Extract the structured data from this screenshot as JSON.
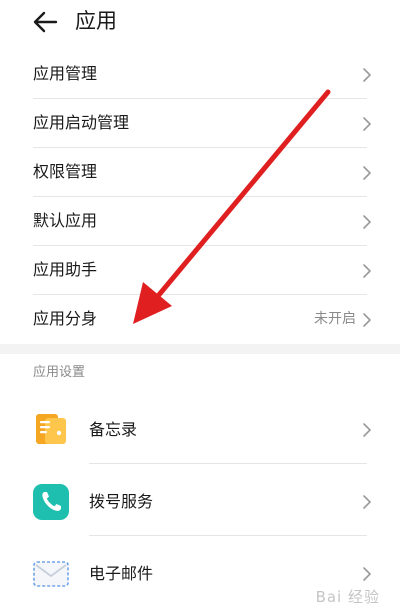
{
  "header": {
    "title": "应用",
    "back_icon": "back-arrow-icon"
  },
  "settings_items": [
    {
      "label": "应用管理"
    },
    {
      "label": "应用启动管理"
    },
    {
      "label": "权限管理"
    },
    {
      "label": "默认应用"
    },
    {
      "label": "应用助手"
    },
    {
      "label": "应用分身",
      "status": "未开启"
    }
  ],
  "section": {
    "title": "应用设置"
  },
  "apps": [
    {
      "label": "备忘录",
      "icon": "notes-app-icon",
      "color": "#f5a623"
    },
    {
      "label": "拨号服务",
      "icon": "phone-app-icon",
      "color": "#1fbfb0"
    },
    {
      "label": "电子邮件",
      "icon": "mail-app-icon",
      "color": "#6fa3e8"
    }
  ],
  "annotation": {
    "arrow_color": "#e02020"
  },
  "watermark": {
    "text": "Bai 经验"
  }
}
